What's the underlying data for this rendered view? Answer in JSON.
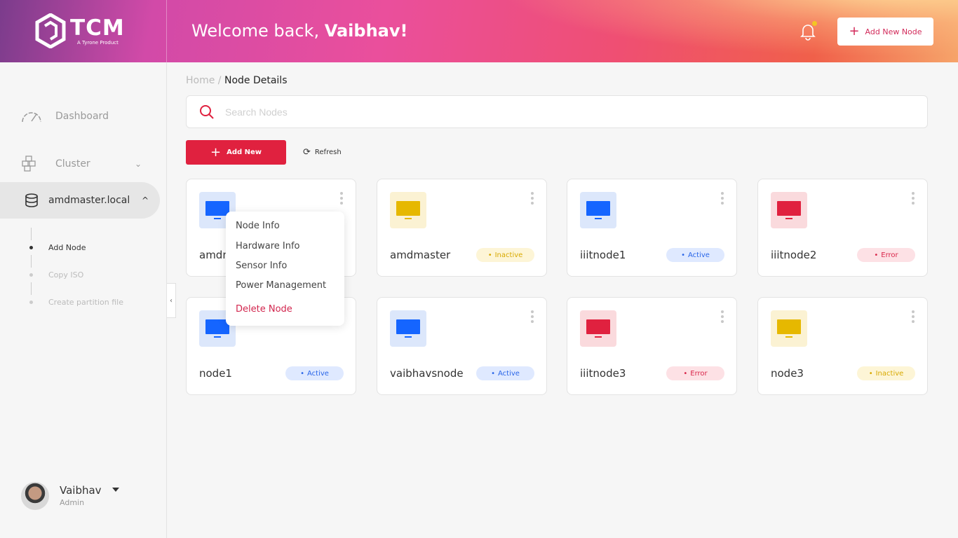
{
  "header": {
    "logo": "TCM",
    "logo_sub": "A Tyrone Product",
    "welcome_prefix": "Welcome back, ",
    "welcome_name": "Vaibhav!",
    "add_button": "Add New Node",
    "notification_dot_color": "#f3c623"
  },
  "sidebar": {
    "items": [
      {
        "label": "Dashboard",
        "icon": "gauge-icon"
      },
      {
        "label": "Cluster",
        "icon": "cubes-icon"
      },
      {
        "label": "amdmaster.local",
        "icon": "database-icon"
      }
    ],
    "subitems": [
      {
        "label": "Add Node",
        "active": true
      },
      {
        "label": "Copy ISO",
        "active": false
      },
      {
        "label": "Create partition file",
        "active": false
      }
    ],
    "user": {
      "name": "Vaibhav",
      "role": "Admin"
    }
  },
  "breadcrumb": {
    "home": "Home",
    "sep": "/",
    "current": "Node Details"
  },
  "search": {
    "placeholder": "Search Nodes",
    "value": ""
  },
  "toolbar": {
    "add_new": "Add New",
    "refresh": "Refresh"
  },
  "status_colors": {
    "Active": {
      "bg": "#dfe9ff",
      "fg": "#2a66e8",
      "icon": "#1565ff",
      "ibox": "#dce7fb"
    },
    "Inactive": {
      "bg": "#fdf5d6",
      "fg": "#d8a900",
      "icon": "#e6b800",
      "ibox": "#fbf2d3"
    },
    "Error": {
      "bg": "#fde1e5",
      "fg": "#d9264a",
      "icon": "#e0213f",
      "ibox": "#fadadd"
    }
  },
  "nodes": [
    {
      "name": "amdmaster",
      "status": ""
    },
    {
      "name": "amdmaster",
      "status": "Inactive"
    },
    {
      "name": "iiitnode1",
      "status": "Active"
    },
    {
      "name": "iiitnode2",
      "status": "Error"
    },
    {
      "name": "node1",
      "status": "Active"
    },
    {
      "name": "vaibhavsnode",
      "status": "Active"
    },
    {
      "name": "iiitnode3",
      "status": "Error"
    },
    {
      "name": "node3",
      "status": "Inactive"
    }
  ],
  "context_menu": {
    "items": [
      "Node Info",
      "Hardware Info",
      "Sensor Info",
      "Power Management"
    ],
    "danger": "Delete Node"
  }
}
